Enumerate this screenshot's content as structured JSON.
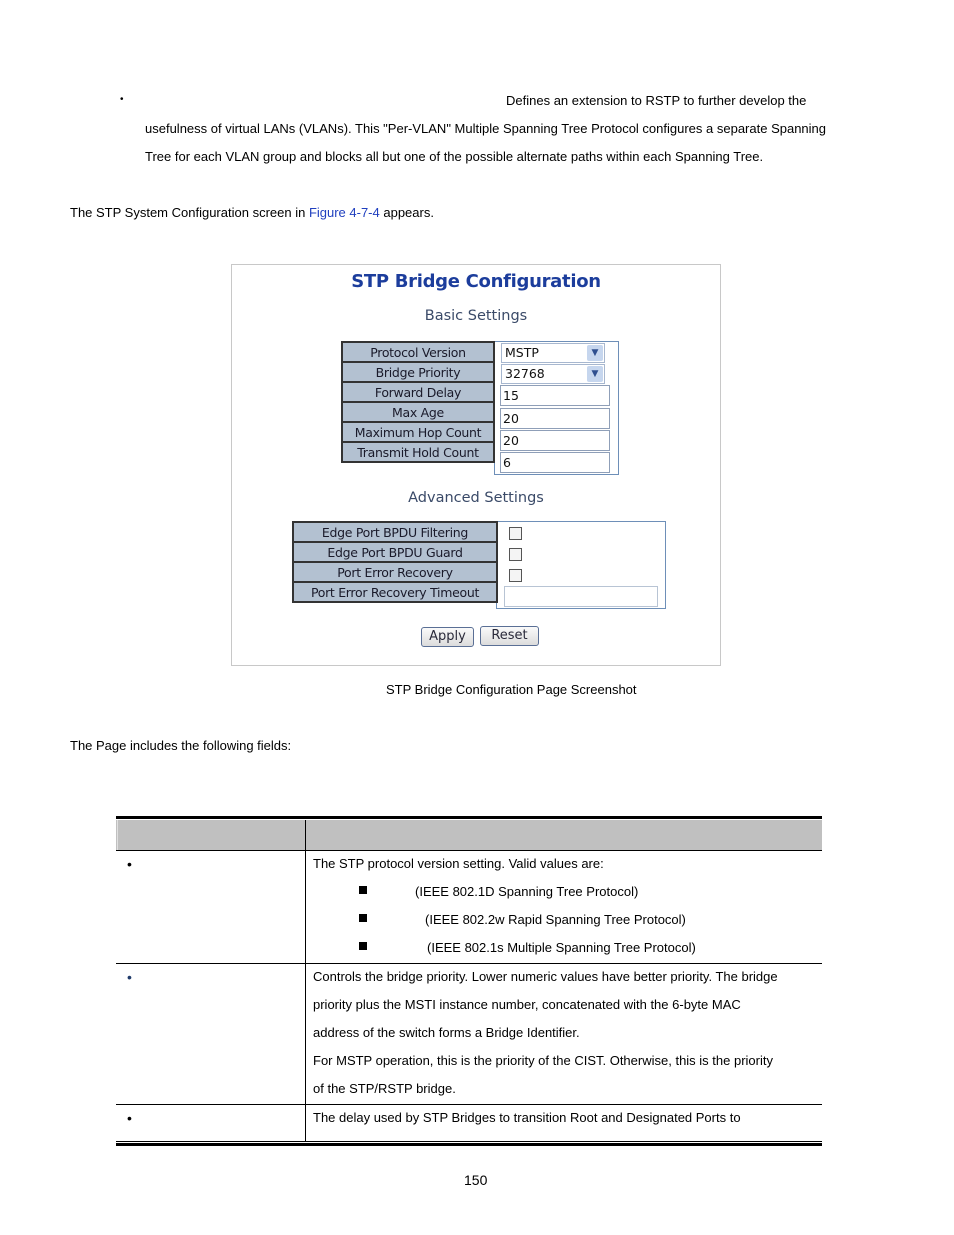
{
  "intro": {
    "bullet_lines": [
      "Defines an extension to RSTP to further develop the",
      "usefulness of virtual LANs (VLANs). This \"Per-VLAN\" Multiple Spanning Tree Protocol configures a separate Spanning",
      "Tree for each VLAN group and blocks all but one of the possible alternate paths within each Spanning Tree."
    ],
    "screen_sentence_pre": "The STP System Configuration screen in ",
    "figure_link": "Figure 4-7-4",
    "screen_sentence_post": " appears."
  },
  "figure": {
    "title": "STP Bridge Configuration",
    "basic_heading": "Basic Settings",
    "basic_settings": [
      {
        "label": "Protocol Version",
        "type": "select",
        "value": "MSTP"
      },
      {
        "label": "Bridge Priority",
        "type": "select",
        "value": "32768"
      },
      {
        "label": "Forward Delay",
        "type": "text",
        "value": "15"
      },
      {
        "label": "Max Age",
        "type": "text",
        "value": "20"
      },
      {
        "label": "Maximum Hop Count",
        "type": "text",
        "value": "20"
      },
      {
        "label": "Transmit Hold Count",
        "type": "text",
        "value": "6"
      }
    ],
    "advanced_heading": "Advanced Settings",
    "advanced_settings": [
      {
        "label": "Edge Port BPDU Filtering",
        "type": "checkbox",
        "checked": false
      },
      {
        "label": "Edge Port BPDU Guard",
        "type": "checkbox",
        "checked": false
      },
      {
        "label": "Port Error Recovery",
        "type": "checkbox",
        "checked": false
      },
      {
        "label": "Port Error Recovery Timeout",
        "type": "text",
        "value": ""
      }
    ],
    "apply_label": "Apply",
    "reset_label": "Reset",
    "caption": "STP Bridge Configuration Page Screenshot"
  },
  "fields_intro": "The Page includes the following fields:",
  "fields_table": {
    "header": [
      "",
      ""
    ],
    "rows": [
      {
        "object": "",
        "description": "The STP protocol version setting. Valid values are:",
        "sub_items": [
          "(IEEE 802.1D Spanning Tree Protocol)",
          "(IEEE 802.2w Rapid Spanning Tree Protocol)",
          "(IEEE 802.1s Multiple Spanning Tree Protocol)"
        ]
      },
      {
        "object": "",
        "description_lines": [
          "Controls the bridge priority. Lower numeric values have better priority. The bridge",
          "priority plus the MSTI instance number, concatenated with the 6-byte MAC",
          "address of the switch forms a Bridge Identifier.",
          "For MSTP operation, this is the priority of the CIST. Otherwise, this is the priority",
          "of the STP/RSTP bridge."
        ]
      },
      {
        "object": "",
        "description": "The delay used by STP Bridges to transition Root and Designated Ports to"
      }
    ]
  },
  "page_number": "150",
  "colors": {
    "link": "#1f3fbf",
    "figure_title": "#1c3d9c",
    "label_cell": "#b3c1d1",
    "table_header": "#c0c0c0"
  }
}
